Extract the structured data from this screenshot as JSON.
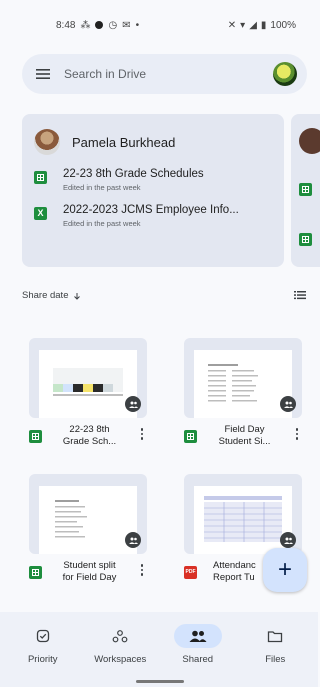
{
  "status_bar": {
    "time": "8:48",
    "battery": "100%"
  },
  "search": {
    "placeholder": "Search in Drive"
  },
  "suggested": {
    "person": "Pamela Burkhead",
    "files": [
      {
        "title": "22-23 8th Grade Schedules",
        "subtitle": "Edited in the past week",
        "type": "sheets"
      },
      {
        "title": "2022-2023 JCMS Employee Info...",
        "subtitle": "Edited in the past week",
        "type": "excel"
      }
    ]
  },
  "sort": {
    "label": "Share date",
    "direction_icon": "arrow-down-icon"
  },
  "grid": [
    {
      "name_line1": "22-23 8th",
      "name_line2": "Grade Sch...",
      "type": "sheets"
    },
    {
      "name_line1": "Field Day",
      "name_line2": "Student Si...",
      "type": "sheets"
    },
    {
      "name_line1": "Student split",
      "name_line2": "for Field Day",
      "type": "sheets"
    },
    {
      "name_line1": "Attendanc",
      "name_line2": "Report Tu",
      "type": "slides"
    }
  ],
  "fab": {
    "label": "+"
  },
  "nav": [
    {
      "label": "Priority",
      "icon": "priority-check-icon"
    },
    {
      "label": "Workspaces",
      "icon": "workspaces-icon"
    },
    {
      "label": "Shared",
      "icon": "shared-people-icon",
      "active": true
    },
    {
      "label": "Files",
      "icon": "folder-icon"
    }
  ],
  "colors": {
    "sheets_green": "#1e8e3e",
    "slides_red": "#d93025",
    "accent": "#d3e3fd"
  }
}
